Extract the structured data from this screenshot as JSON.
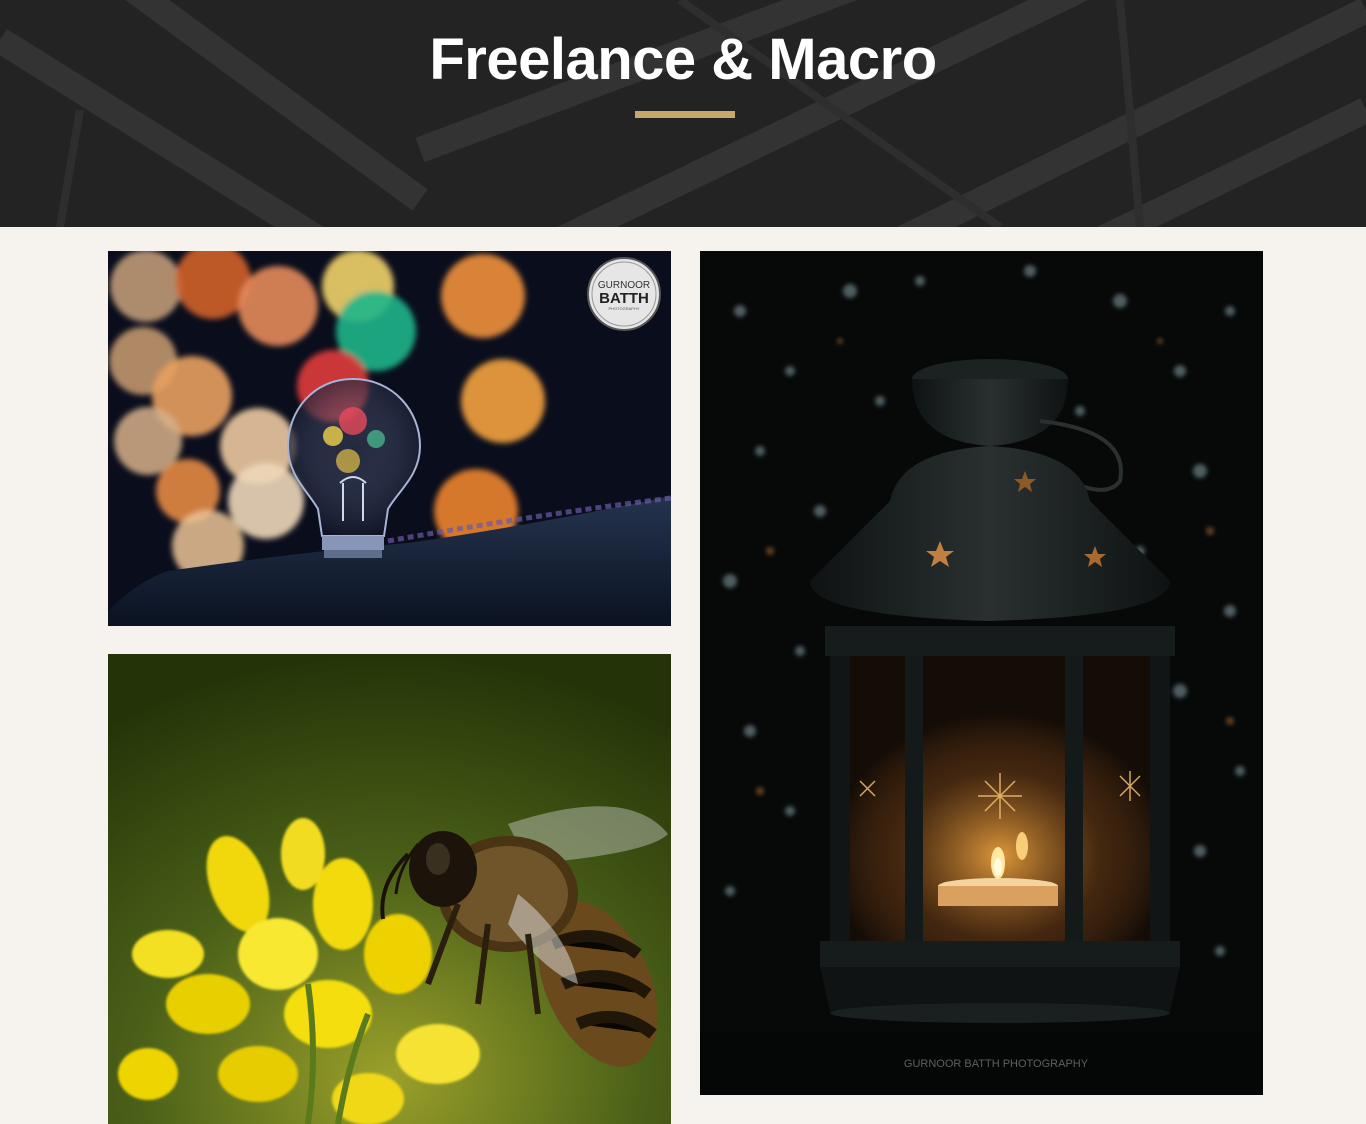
{
  "header": {
    "title": "Freelance & Macro"
  },
  "colors": {
    "accent": "#c9a66b",
    "page_background": "#f6f3ee",
    "hero_background": "#222222"
  },
  "gallery": {
    "photos": [
      {
        "subject": "light bulb with bokeh",
        "watermark_logo": {
          "line1": "GURNOOR",
          "line2": "BATTH",
          "line3": "PHOTOGRAPHY"
        }
      },
      {
        "subject": "lantern with candles",
        "watermark_text": "GURNOOR BATTH PHOTOGRAPHY"
      },
      {
        "subject": "bee on yellow flower"
      }
    ]
  }
}
